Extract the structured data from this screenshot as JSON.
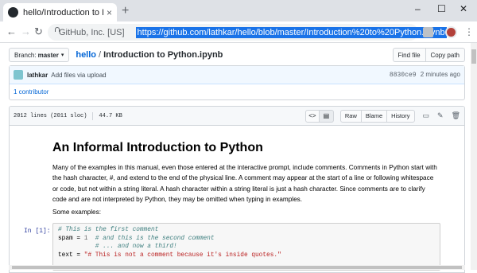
{
  "browser": {
    "tab_title": "hello/Introduction to Python.ipynb",
    "tab_close": "×",
    "new_tab": "+",
    "window_controls": [
      "–",
      "☐",
      "✕"
    ],
    "back": "←",
    "forward": "→",
    "reload": "↻",
    "site_identity": "GitHub, Inc. [US]",
    "url": "https://github.com/lathkar/hello/blob/master/Introduction%20to%20Python.ipynb",
    "bookmark": "☆",
    "menu": "⋮"
  },
  "repo": {
    "branch_label": "Branch:",
    "branch_name": "master",
    "caret": "▾",
    "repo_name": "hello",
    "slash": "/",
    "file_name": "Introduction to Python.ipynb",
    "find_file": "Find file",
    "copy_path": "Copy path"
  },
  "commit": {
    "author": "lathkar",
    "message": "Add files via upload",
    "sha": "8830ce9",
    "time": "2 minutes ago",
    "contributors": "1 contributor"
  },
  "file_header": {
    "lines": "2012 lines (2011 sloc)",
    "size": "44.7 KB",
    "code_icon": "<>",
    "rich_icon": "▤",
    "raw": "Raw",
    "blame": "Blame",
    "history": "History",
    "desktop_icon": "▭",
    "edit_icon": "✎",
    "delete_icon": "🗑"
  },
  "notebook": {
    "heading": "An Informal Introduction to Python",
    "paragraph": "Many of the examples in this manual, even those entered at the interactive prompt, include comments. Comments in Python start with the hash character, #, and extend to the end of the physical line. A comment may appear at the start of a line or following whitespace or code, but not within a string literal. A hash character within a string literal is just a hash character. Since comments are to clarify code and are not interpreted by Python, they may be omitted when typing in examples.",
    "examples_label": "Some examples:",
    "prompt": "In [1]:",
    "code": {
      "line1_comment": "# This is the first comment",
      "line2_code": "spam = ",
      "line2_num": "1",
      "line2_comment": "  # and this is the second comment",
      "line3_indent": "          ",
      "line3_comment": "# ... and now a third!",
      "line4_code": "text = ",
      "line4_str": "\"# This is not a comment because it's inside quotes.\""
    }
  }
}
